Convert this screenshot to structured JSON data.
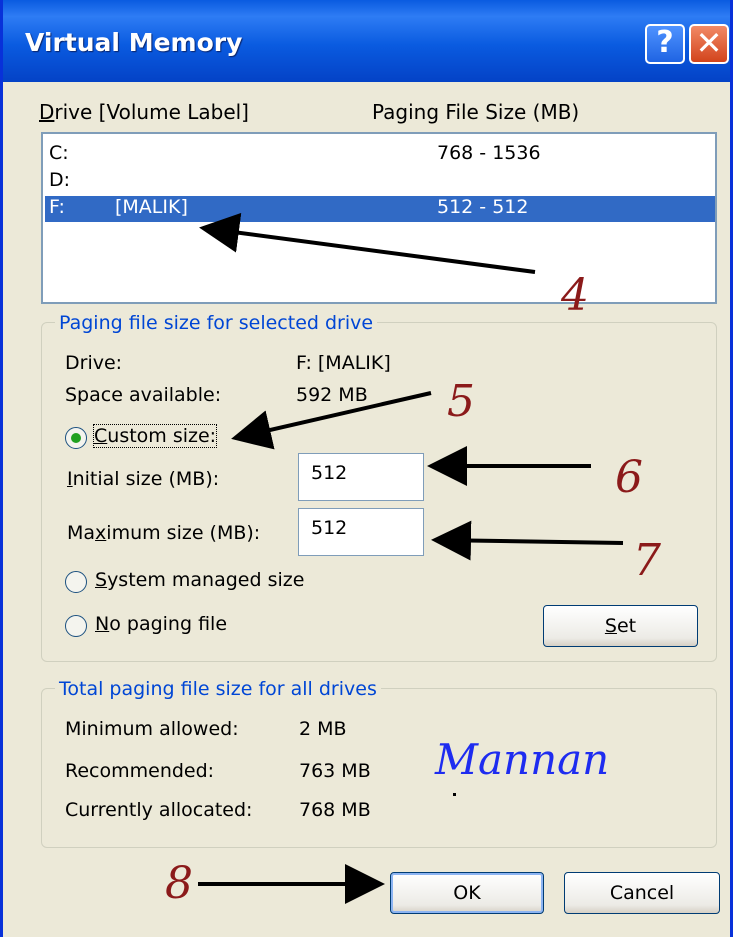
{
  "window": {
    "title": "Virtual Memory"
  },
  "titlebar": {
    "help_icon": "?",
    "close_icon": "✕"
  },
  "drive_list": {
    "col_drive_prefix": "",
    "col_drive_underlined": "D",
    "col_drive_rest": "rive  [Volume Label]",
    "col_size": "Paging File Size (MB)",
    "rows": [
      {
        "drive": "C:",
        "label": "",
        "size": "768 - 1536",
        "selected": false
      },
      {
        "drive": "D:",
        "label": "",
        "size": "",
        "selected": false
      },
      {
        "drive": "F:",
        "label": "[MALIK]",
        "size": "512 - 512",
        "selected": true
      }
    ]
  },
  "selected_drive_group": {
    "legend": "Paging file size for selected drive",
    "drive_label": "Drive:",
    "drive_value": "F:  [MALIK]",
    "space_label": "Space available:",
    "space_value": "592 MB",
    "custom_size": {
      "u": "C",
      "rest": "ustom size:",
      "checked": true
    },
    "initial_label": {
      "u": "I",
      "rest": "nitial size (MB):"
    },
    "initial_value": "512",
    "max_label": {
      "pre": "Ma",
      "u": "x",
      "rest": "imum size (MB):"
    },
    "max_value": "512",
    "system_managed": {
      "pre": "",
      "u": "S",
      "rest": "ystem managed size",
      "checked": false
    },
    "no_paging": {
      "pre": "",
      "u": "N",
      "rest": "o paging file",
      "checked": false
    },
    "set_button": {
      "u": "S",
      "rest": "et"
    }
  },
  "totals_group": {
    "legend": "Total paging file size for all drives",
    "min_label": "Minimum allowed:",
    "min_value": "2 MB",
    "rec_label": "Recommended:",
    "rec_value": "763 MB",
    "cur_label": "Currently allocated:",
    "cur_value": "768 MB"
  },
  "buttons": {
    "ok": "OK",
    "cancel": "Cancel"
  },
  "annotations": {
    "signature": "Mannan",
    "numbers": [
      "4",
      "5",
      "6",
      "7",
      "8"
    ],
    "color": "#8B1A1A"
  },
  "colors": {
    "title_bar": "#0A5BE0",
    "selection": "#316AC5",
    "group_legend": "#0046D5"
  }
}
